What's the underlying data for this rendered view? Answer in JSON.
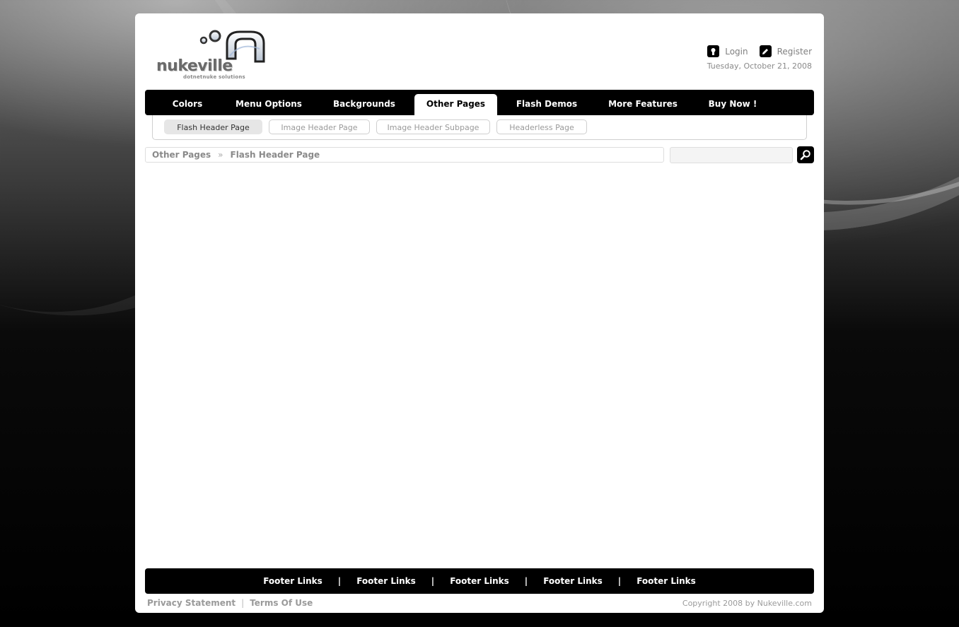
{
  "logo": {
    "word": "nukeville",
    "tagline": "dotnetnuke solutions"
  },
  "header": {
    "login_label": "Login",
    "register_label": "Register",
    "date": "Tuesday, October 21, 2008"
  },
  "main_nav": {
    "items": [
      {
        "label": "Colors"
      },
      {
        "label": "Menu Options"
      },
      {
        "label": "Backgrounds"
      },
      {
        "label": "Other Pages",
        "active": true
      },
      {
        "label": "Flash Demos"
      },
      {
        "label": "More Features"
      },
      {
        "label": "Buy Now !"
      }
    ]
  },
  "sub_nav": {
    "items": [
      {
        "label": "Flash Header Page",
        "active": true
      },
      {
        "label": "Image Header Page"
      },
      {
        "label": "Image Header Subpage"
      },
      {
        "label": "Headerless Page"
      }
    ]
  },
  "breadcrumb": {
    "items": [
      "Other Pages",
      "Flash Header Page"
    ],
    "separator": "»"
  },
  "search": {
    "value": "",
    "placeholder": "",
    "icon": "search-icon"
  },
  "footer": {
    "links": [
      "Footer Links",
      "Footer Links",
      "Footer Links",
      "Footer Links",
      "Footer Links"
    ],
    "separator": "|",
    "privacy_label": "Privacy Statement",
    "divider": "|",
    "terms_label": "Terms Of Use",
    "copyright": "Copyright 2008 by Nukeville.com"
  },
  "colors": {
    "nav_background": "#000000",
    "page_background": "#ffffff",
    "muted_text": "#8a8a8a"
  }
}
